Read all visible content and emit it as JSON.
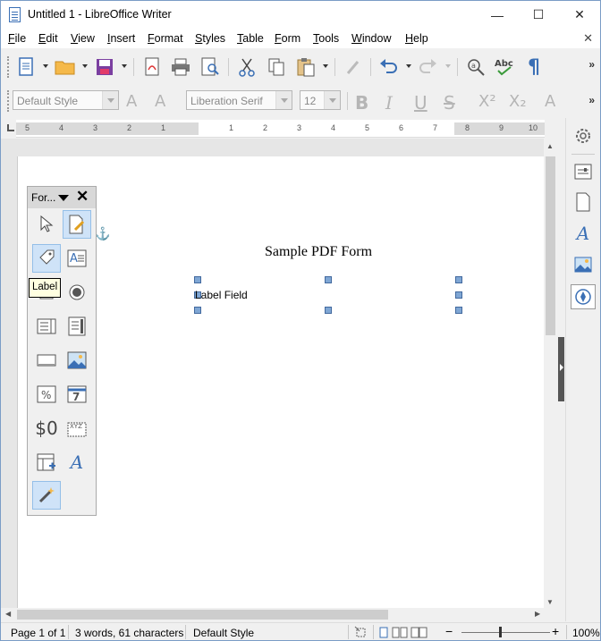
{
  "window": {
    "title": "Untitled 1 - LibreOffice Writer"
  },
  "title_buttons": {
    "minimize": "—",
    "maximize": "☐",
    "close": "✕"
  },
  "menu": [
    {
      "label": "File",
      "accel": "F",
      "rest": "ile"
    },
    {
      "label": "Edit",
      "accel": "E",
      "rest": "dit"
    },
    {
      "label": "View",
      "accel": "V",
      "rest": "iew"
    },
    {
      "label": "Insert",
      "accel": "I",
      "rest": "nsert"
    },
    {
      "label": "Format",
      "accel": "F",
      "rest": "ormat"
    },
    {
      "label": "Styles",
      "accel": "S",
      "rest": "tyles"
    },
    {
      "label": "Table",
      "accel": "T",
      "rest": "able"
    },
    {
      "label": "Form",
      "accel": "F",
      "rest": "orm"
    },
    {
      "label": "Tools",
      "accel": "T",
      "rest": "ools"
    },
    {
      "label": "Window",
      "accel": "W",
      "rest": "indow"
    },
    {
      "label": "Help",
      "accel": "H",
      "rest": "elp"
    }
  ],
  "doc_close": "✕",
  "formatting": {
    "paragraph_style": "Default Style",
    "font_name": "Liberation Serif",
    "font_size": "12"
  },
  "ruler": {
    "numbers": [
      "5",
      "4",
      "3",
      "2",
      "1",
      "1",
      "2",
      "3",
      "4",
      "5",
      "6",
      "7",
      "8",
      "9",
      "10"
    ]
  },
  "document": {
    "title": "Sample PDF Form",
    "label_field": "Label Field"
  },
  "form_controls": {
    "title": "For...",
    "close": "✕",
    "tooltip": "Label",
    "numeric_glyph": "$0",
    "date_glyph": "7",
    "pattern_glyph": "XYZ"
  },
  "status": {
    "page": "Page 1 of 1",
    "words": "3 words, 61 characters",
    "style": "Default Style",
    "zoom": "100%",
    "zoom_minus": "−",
    "zoom_plus": "+"
  },
  "colors": {
    "accent": "#3a6fb5",
    "selection": "#cfe3f8",
    "handle": "#7fa6d4"
  }
}
